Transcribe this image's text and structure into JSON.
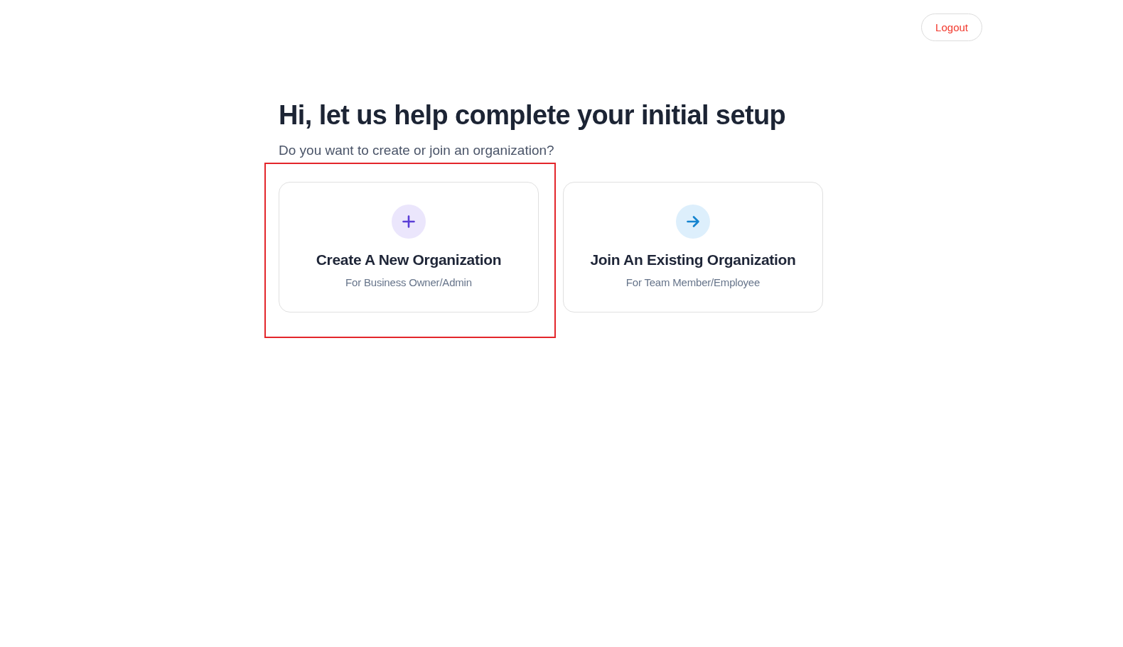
{
  "header": {
    "logout_button": "Logout"
  },
  "heading": "Hi, let us help complete your initial setup",
  "subheading": "Do you want to create or join an organization?",
  "options": [
    {
      "kind": "create",
      "title": "Create A New Organization",
      "subtitle": "For Business Owner/Admin",
      "selected": true
    },
    {
      "kind": "join",
      "title": "Join An Existing Organization",
      "subtitle": "For Team Member/Employee",
      "selected": false
    }
  ]
}
